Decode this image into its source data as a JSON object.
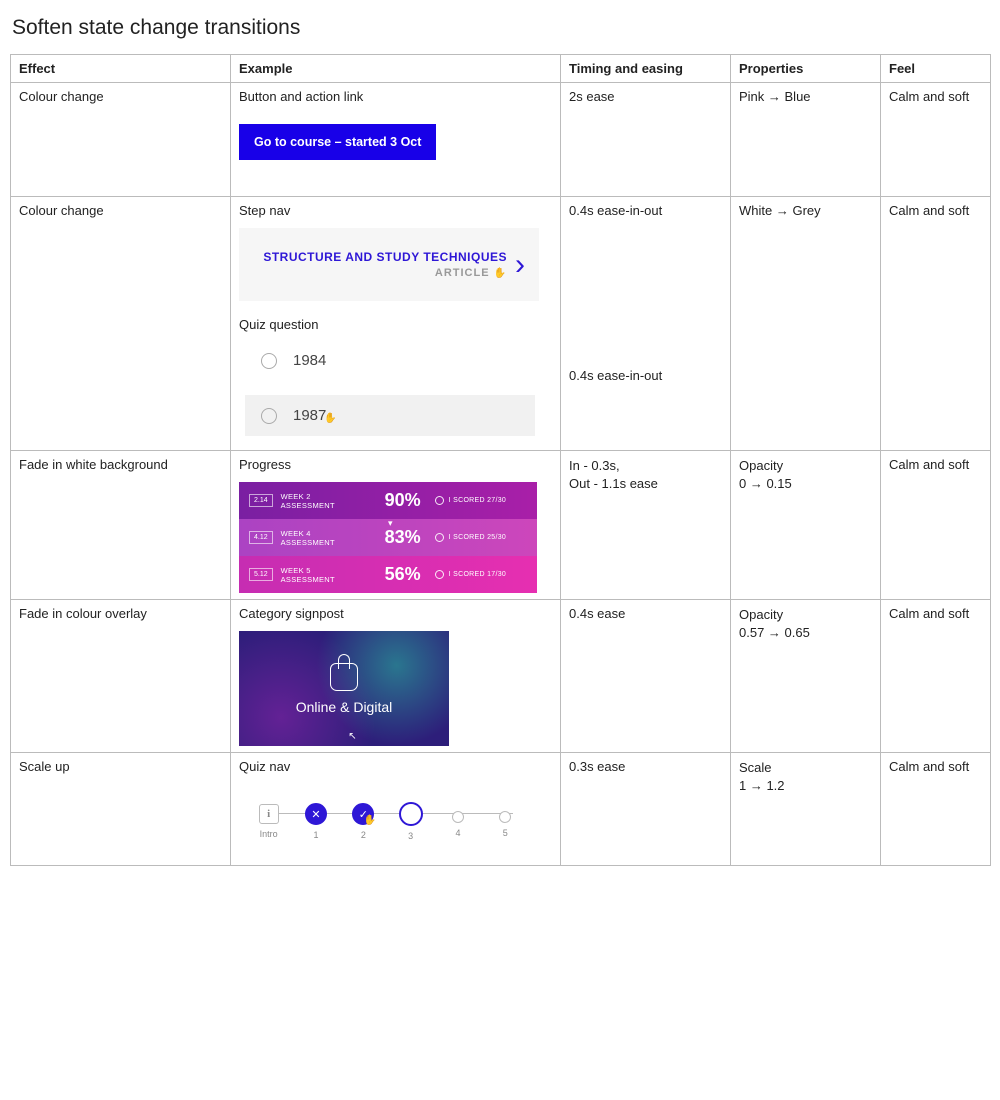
{
  "title": "Soften state change transitions",
  "headers": [
    "Effect",
    "Example",
    "Timing and easing",
    "Properties",
    "Feel"
  ],
  "rows": [
    {
      "effect": "Colour change",
      "example_label": "Button and action link",
      "button_text": "Go to course – started 3 Oct",
      "timing": "2s ease",
      "properties": "Pink → Blue",
      "feel": "Calm and soft"
    },
    {
      "effect": "Colour change",
      "example_label": "Step nav",
      "stepnav_title": "STRUCTURE AND STUDY TECHNIQUES",
      "stepnav_sub": "ARTICLE",
      "timing": "0.4s ease-in-out",
      "example_label2": "Quiz question",
      "quiz_opt1": "1984",
      "quiz_opt2": "1987",
      "timing2": "0.4s ease-in-out",
      "properties": "White → Grey",
      "feel": "Calm and soft"
    },
    {
      "effect": "Fade in white background",
      "example_label": "Progress",
      "progress": [
        {
          "idx": "2.14",
          "name": "WEEK 2 ASSESSMENT",
          "pct": "90%",
          "scored": "I SCORED 27/30"
        },
        {
          "idx": "4.12",
          "name": "WEEK 4 ASSESSMENT",
          "pct": "83%",
          "scored": "I SCORED 25/30"
        },
        {
          "idx": "5.12",
          "name": "WEEK 5 ASSESSMENT",
          "pct": "56%",
          "scored": "I SCORED 17/30"
        }
      ],
      "timing": "In - 0.3s,\nOut - 1.1s ease",
      "properties": "Opacity\n0 → 0.15",
      "feel": "Calm and soft"
    },
    {
      "effect": "Fade in colour overlay",
      "example_label": "Category signpost",
      "signpost_label": "Online & Digital",
      "timing": "0.4s ease",
      "properties": "Opacity\n0.57 → 0.65",
      "feel": "Calm and soft"
    },
    {
      "effect": "Scale up",
      "example_label": "Quiz nav",
      "qnav_labels": [
        "Intro",
        "1",
        "2",
        "3",
        "4",
        "5"
      ],
      "qnav_intro_glyph": "i",
      "timing": "0.3s ease",
      "properties": "Scale\n1 → 1.2",
      "feel": "Calm and soft"
    }
  ]
}
